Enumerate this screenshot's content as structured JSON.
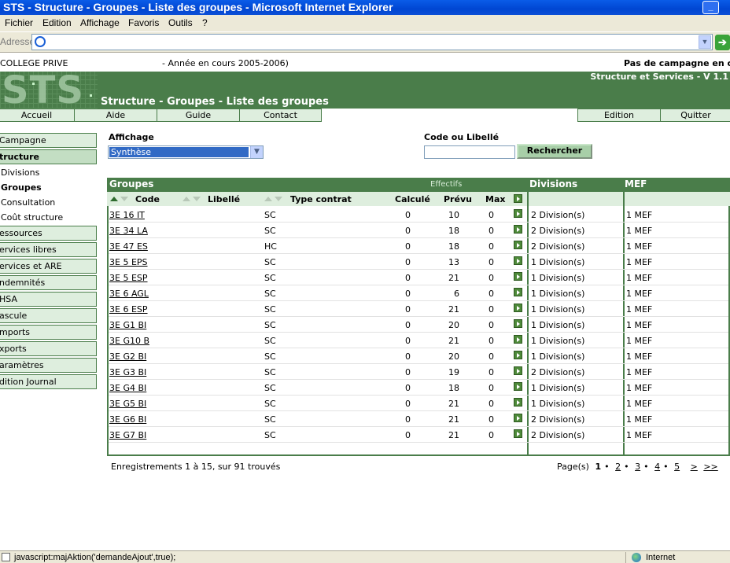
{
  "window": {
    "title": "STS - Structure - Groupes - Liste des groupes - Microsoft Internet Explorer",
    "minimize": "_"
  },
  "menu": [
    "Fichier",
    "Edition",
    "Affichage",
    "Favoris",
    "Outils",
    "?"
  ],
  "address": {
    "label": "Adresse",
    "value": ""
  },
  "header": {
    "etablissement": "COLLEGE PRIVE",
    "annee": "- Année en cours 2005-2006)",
    "campagne": "Pas de campagne en cou",
    "logo": "STS",
    "title": "Structure - Groupes - Liste des groupes",
    "version": "Structure et Services - V 1.1"
  },
  "topnav": {
    "accueil": "Accueil",
    "aide": "Aide",
    "guide": "Guide",
    "contact": "Contact",
    "edition": "Edition",
    "quitter": "Quitter"
  },
  "leftmenu": {
    "campagne": "Campagne",
    "structure": "tructure",
    "divisions": "Divisions",
    "groupes": "Groupes",
    "consultation": "Consultation",
    "cout": "Coût structure",
    "ressources": "essources",
    "services_libres": "ervices libres",
    "services_are": "ervices et ARE",
    "indemnites": "ndemnités",
    "hsa": "HSA",
    "bascule": "ascule",
    "imports": "mports",
    "exports": "xports",
    "parametres": "aramètres",
    "edition_journal": "dition Journal"
  },
  "filters": {
    "affichage_label": "Affichage",
    "affichage_value": "Synthèse",
    "code_label": "Code ou Libellé",
    "code_value": "",
    "search_button": "Rechercher"
  },
  "table": {
    "groupes_header": "Groupes",
    "effectifs_header": "Effectifs",
    "divisions_header": "Divisions",
    "mef_header": "MEF",
    "columns": {
      "code": "Code",
      "libelle": "Libellé",
      "type": "Type contrat",
      "calcule": "Calculé",
      "prevu": "Prévu",
      "max": "Max"
    },
    "rows": [
      {
        "code": "3E 16 IT",
        "type": "SC",
        "calc": "0",
        "prev": "10",
        "max": "0",
        "div": "2 Division(s)",
        "mef": "1 MEF"
      },
      {
        "code": "3E 34 LA",
        "type": "SC",
        "calc": "0",
        "prev": "18",
        "max": "0",
        "div": "2 Division(s)",
        "mef": "1 MEF"
      },
      {
        "code": "3E 47 ES",
        "type": "HC",
        "calc": "0",
        "prev": "18",
        "max": "0",
        "div": "2 Division(s)",
        "mef": "1 MEF"
      },
      {
        "code": "3E 5 EPS",
        "type": "SC",
        "calc": "0",
        "prev": "13",
        "max": "0",
        "div": "1 Division(s)",
        "mef": "1 MEF"
      },
      {
        "code": "3E 5 ESP",
        "type": "SC",
        "calc": "0",
        "prev": "21",
        "max": "0",
        "div": "1 Division(s)",
        "mef": "1 MEF"
      },
      {
        "code": "3E 6 AGL",
        "type": "SC",
        "calc": "0",
        "prev": "6",
        "max": "0",
        "div": "1 Division(s)",
        "mef": "1 MEF"
      },
      {
        "code": "3E 6 ESP",
        "type": "SC",
        "calc": "0",
        "prev": "21",
        "max": "0",
        "div": "1 Division(s)",
        "mef": "1 MEF"
      },
      {
        "code": "3E G1 BI",
        "type": "SC",
        "calc": "0",
        "prev": "20",
        "max": "0",
        "div": "1 Division(s)",
        "mef": "1 MEF"
      },
      {
        "code": "3E G10 B",
        "type": "SC",
        "calc": "0",
        "prev": "21",
        "max": "0",
        "div": "1 Division(s)",
        "mef": "1 MEF"
      },
      {
        "code": "3E G2 BI",
        "type": "SC",
        "calc": "0",
        "prev": "20",
        "max": "0",
        "div": "1 Division(s)",
        "mef": "1 MEF"
      },
      {
        "code": "3E G3 BI",
        "type": "SC",
        "calc": "0",
        "prev": "19",
        "max": "0",
        "div": "2 Division(s)",
        "mef": "1 MEF"
      },
      {
        "code": "3E G4 BI",
        "type": "SC",
        "calc": "0",
        "prev": "18",
        "max": "0",
        "div": "1 Division(s)",
        "mef": "1 MEF"
      },
      {
        "code": "3E G5 BI",
        "type": "SC",
        "calc": "0",
        "prev": "21",
        "max": "0",
        "div": "1 Division(s)",
        "mef": "1 MEF"
      },
      {
        "code": "3E G6 BI",
        "type": "SC",
        "calc": "0",
        "prev": "21",
        "max": "0",
        "div": "2 Division(s)",
        "mef": "1 MEF"
      },
      {
        "code": "3E G7 BI",
        "type": "SC",
        "calc": "0",
        "prev": "21",
        "max": "0",
        "div": "2 Division(s)",
        "mef": "1 MEF"
      }
    ]
  },
  "footer": {
    "count": "Enregistrements 1 à 15, sur 91 trouvés",
    "page_label": "Page(s)",
    "pages": [
      "1",
      "2",
      "3",
      "4",
      "5"
    ],
    "next": ">",
    "last": ">>"
  },
  "status": {
    "text": "javascript:majAktion('demandeAjout',true);",
    "zone": "Internet"
  },
  "colors": {
    "brand_green": "#4a7d4a",
    "light_green": "#deeede",
    "select_blue": "#316ac5"
  }
}
